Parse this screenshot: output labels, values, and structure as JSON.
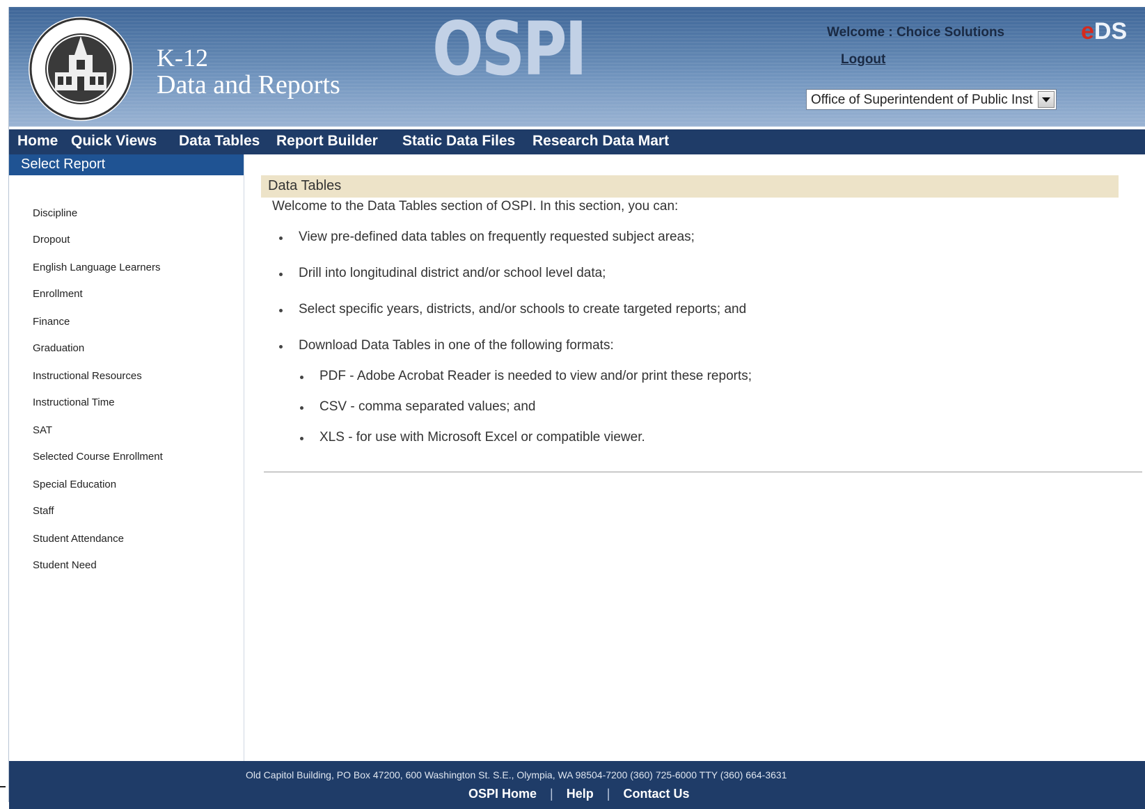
{
  "header": {
    "brand_line1": "K-12",
    "brand_line2": "Data and Reports",
    "ospi_logo": "OSPI",
    "welcome": "Welcome : Choice Solutions",
    "logout": "Logout",
    "eds_logo_e": "e",
    "eds_logo_rest": "DS",
    "org_select_value": "Office of Superintendent of Public Instruction"
  },
  "nav": {
    "items": [
      "Home",
      "Quick Views",
      "Data Tables",
      "Report Builder",
      "Static Data Files",
      "Research Data Mart"
    ]
  },
  "sidebar": {
    "title": "Select Report",
    "items": [
      "Discipline",
      "Dropout",
      "English Language Learners",
      "Enrollment",
      "Finance",
      "Graduation",
      "Instructional Resources",
      "Instructional Time",
      "SAT",
      "Selected Course Enrollment",
      "Special Education",
      "Staff",
      "Student Attendance",
      "Student Need"
    ]
  },
  "content": {
    "title": "Data Tables",
    "intro": "Welcome to the Data Tables section of OSPI. In this section, you can:",
    "bullets": [
      "View pre-defined data tables on frequently requested subject areas;",
      "Drill into longitudinal district and/or school level data;",
      "Select specific years, districts, and/or schools to create targeted reports; and",
      "Download Data Tables in one of the following formats:"
    ],
    "sub_bullets": [
      "PDF - Adobe Acrobat Reader is needed to view and/or print these reports;",
      "CSV - comma separated values; and",
      "XLS - for use with Microsoft Excel or compatible viewer."
    ]
  },
  "footer": {
    "address": "Old Capitol Building, PO Box 47200, 600 Washington St. S.E., Olympia, WA  98504-7200  (360) 725-6000  TTY (360) 664-3631",
    "links": [
      "OSPI Home",
      "Help",
      "Contact Us"
    ],
    "separator": "|"
  },
  "colors": {
    "header_top": "#3d6597",
    "nav_bg": "#1f3c68",
    "sidebar_title_bg": "#1f5393",
    "content_title_bg": "#ede3c8",
    "eds_red": "#d52a1e"
  }
}
